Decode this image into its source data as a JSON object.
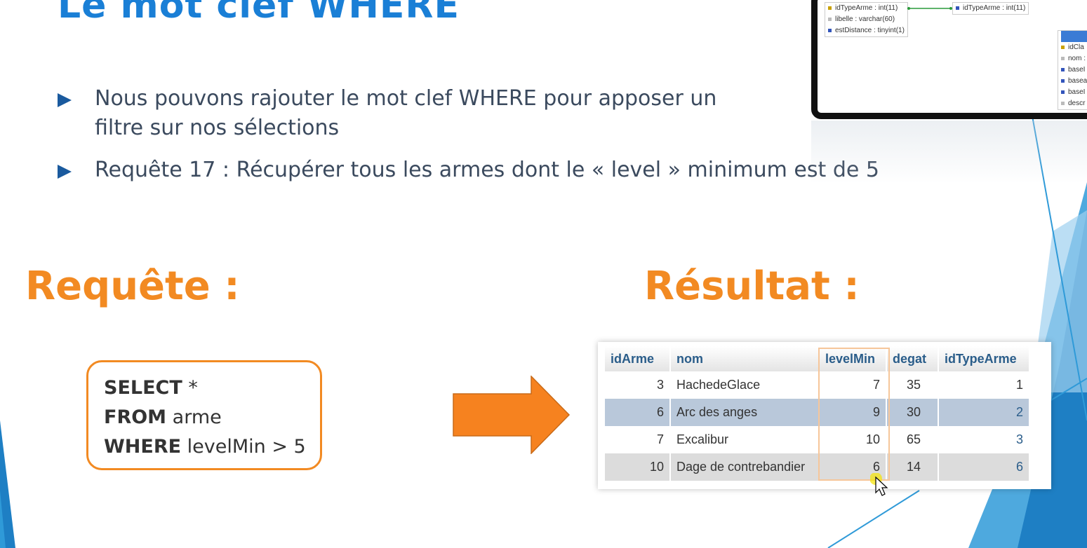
{
  "slide": {
    "title": "Le mot clef WHERE",
    "bullets": [
      "Nous pouvons rajouter le mot clef WHERE pour apposer un filtre sur nos sélections",
      "Requête 17 : Récupérer tous les armes dont le « level » minimum est de 5"
    ],
    "heading_query": "Requête :",
    "heading_result": "Résultat :",
    "sql": {
      "line1_kw": "SELECT",
      "line1_rest": " *",
      "line2_kw": "FROM",
      "line2_rest": " arme",
      "line3_kw": "WHERE",
      "line3_rest": " levelMin > 5"
    }
  },
  "result_table": {
    "columns": [
      "idArme",
      "nom",
      "levelMin",
      "degat",
      "idTypeArme"
    ],
    "rows": [
      [
        "3",
        "HachedeGlace",
        "7",
        "35",
        "1"
      ],
      [
        "6",
        "Arc des anges",
        "9",
        "30",
        "2"
      ],
      [
        "7",
        "Excalibur",
        "10",
        "65",
        "3"
      ],
      [
        "10",
        "Dage de contrebandier",
        "6",
        "14",
        "6"
      ]
    ]
  },
  "diagram": {
    "table1_fields": [
      "idTypeArme : int(11)",
      "libelle : varchar(60)",
      "estDistance : tinyint(1)"
    ],
    "table2_fields": [
      "idTypeArme : int(11)"
    ],
    "table3_fields": [
      "idCla",
      "nom :",
      "baseI",
      "basea",
      "baseI",
      "descr"
    ]
  },
  "colors": {
    "title": "#1a7fd6",
    "heading": "#f28a22",
    "bullet_arrow": "#1a5a9e",
    "accent_blue": "#1e88d8"
  }
}
